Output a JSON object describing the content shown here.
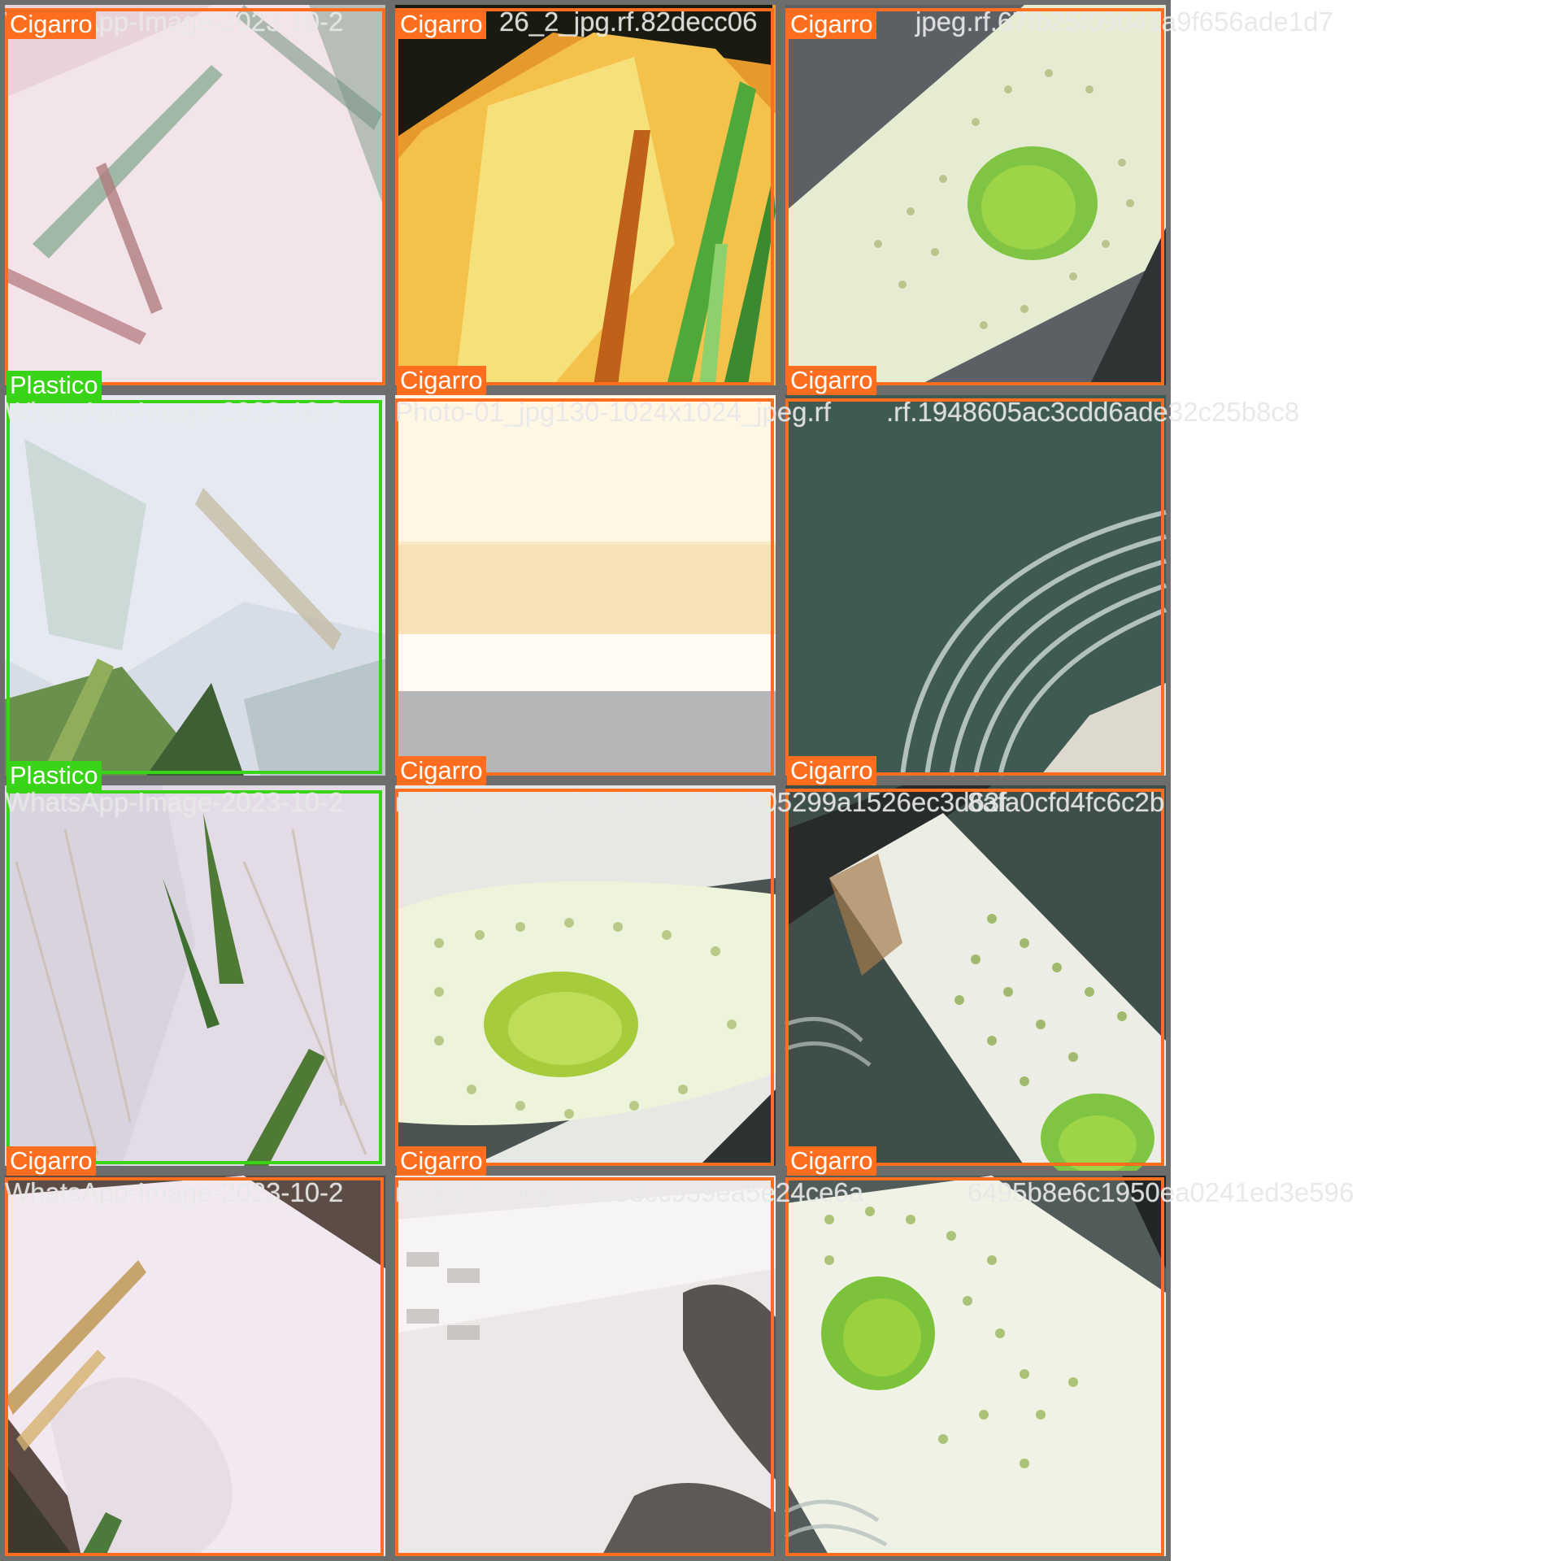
{
  "colors": {
    "cigarro": "#ff6e1f",
    "plastico": "#39d418",
    "tile_border": "#6d6d6d",
    "filename_text": "#e8e8e8"
  },
  "labels": {
    "r0c0": "Cigarro",
    "r0c1": "Cigarro",
    "r0c2": "Cigarro",
    "r1c0": "Plastico",
    "r1c1": "Cigarro",
    "r1c2": "Cigarro",
    "r2c0": "Plastico",
    "r2c1": "Cigarro",
    "r2c2": "Cigarro",
    "r3c0": "Cigarro",
    "r3c1": "Cigarro",
    "r3c2": "Cigarro"
  },
  "filenames": {
    "row0_a": "WhatsApp-Image-2023-10-2",
    "row0_b": "26_2_jpg.rf.82decc06",
    "row0_c": "jpeg.rf.67fb25f09041a9f656ade1d7",
    "row1_a": "WhatsApp-Image-2023-10-2",
    "row1_b": "Photo-01_jpg130-1024x1024_jpeg.rf",
    "row1_c": ".rf.1948605ac3cdd6ade32c25b8c8",
    "row2_a": "WhatsApp-Image-2023-10-2",
    "row2_b": "rueba-2_jpeg.rf.4b15c6e3720605299a1526ec3d63f",
    "row2_c": "8afa0cfd4fc6c2b",
    "row3_a": "WhatsApp-Image-2023-10-2",
    "row3_b": "rueba-1_jpeg.rf.a553cc939ea5e24ce6a",
    "row3_c": "6495b8e6c1950ea0241ed3e596"
  }
}
